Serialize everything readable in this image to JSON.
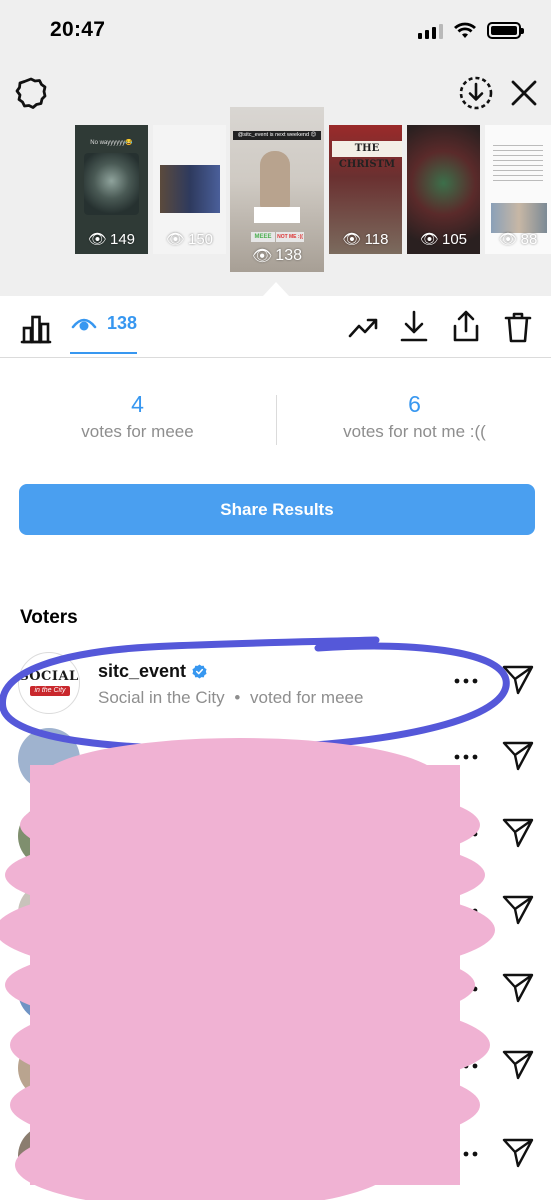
{
  "status_bar": {
    "time": "20:47"
  },
  "icons": {
    "settings": "settings-ring-icon",
    "download_story": "download-circle-icon",
    "close": "close-icon",
    "insights": "bar-chart-icon",
    "viewers": "eye-icon",
    "promote": "trend-arrow-icon",
    "save": "download-icon",
    "share": "share-icon",
    "delete": "trash-icon",
    "more": "more-icon",
    "send": "send-icon",
    "verified": "verified-badge-icon"
  },
  "stories": [
    {
      "views": "149",
      "caption": "No wayyyyyy😂"
    },
    {
      "views": "150"
    },
    {
      "views": "138",
      "caption": "@sitc_event is next weekend 😊",
      "selected": true,
      "poll_left": "MEEE",
      "poll_right": "NOT ME :(( "
    },
    {
      "views": "118",
      "caption": "THE CHRISTM"
    },
    {
      "views": "105"
    },
    {
      "views": "88"
    }
  ],
  "toolbar": {
    "viewer_count": "138"
  },
  "poll": {
    "options": [
      {
        "count": "4",
        "label": "votes for meee"
      },
      {
        "count": "6",
        "label": "votes for not me :(("
      }
    ]
  },
  "share_results_label": "Share Results",
  "voters_heading": "Voters",
  "voters": [
    {
      "username": "sitc_event",
      "verified": true,
      "full_name": "Social in the City",
      "separator": "•",
      "vote": "voted for meee",
      "logo_text": "SOCIAL",
      "logo_ribbon": "in the City"
    }
  ],
  "partial_visible_text": "me :((",
  "colors": {
    "accent_blue": "#3797f0",
    "button_blue": "#4a9ff0",
    "highlight_stroke": "#5558d9",
    "redaction_pink": "#f0b2d3"
  }
}
